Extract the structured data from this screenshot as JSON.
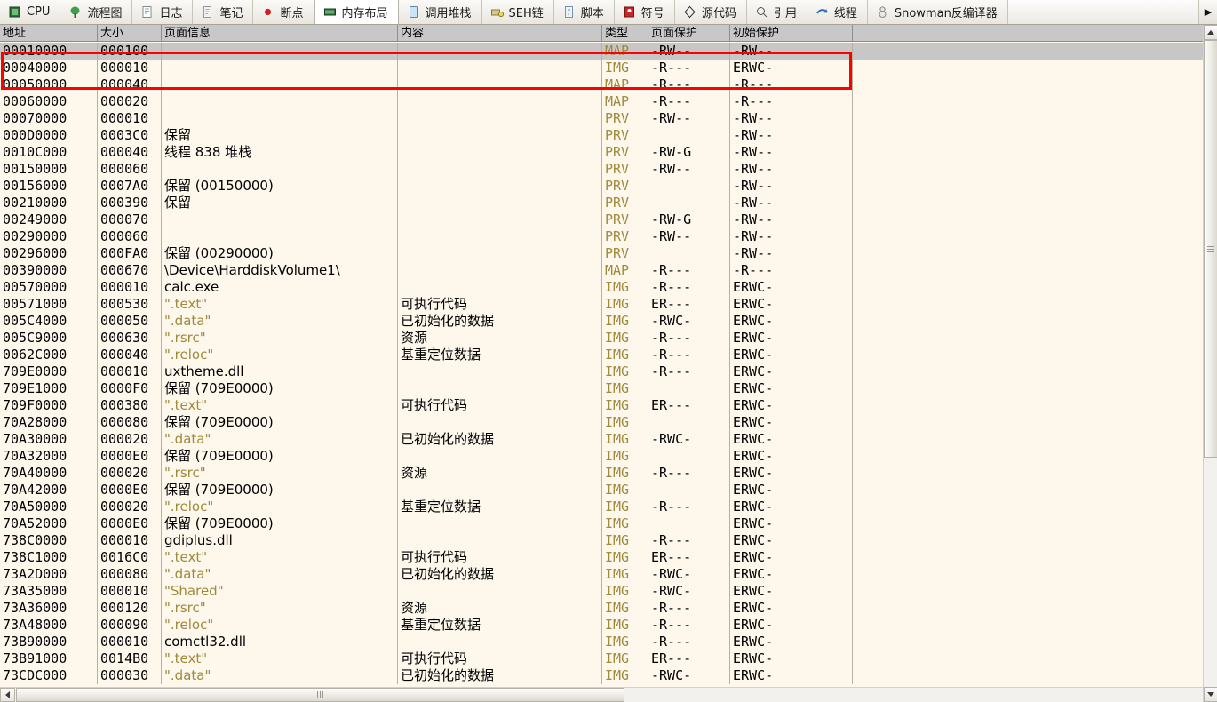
{
  "tabs": [
    {
      "label": "CPU",
      "icon": "cpu-icon",
      "active": false
    },
    {
      "label": "流程图",
      "icon": "graph-icon",
      "active": false
    },
    {
      "label": "日志",
      "icon": "log-icon",
      "active": false
    },
    {
      "label": "笔记",
      "icon": "notes-icon",
      "active": false
    },
    {
      "label": "断点",
      "icon": "breakpoint-icon",
      "active": false
    },
    {
      "label": "内存布局",
      "icon": "memory-icon",
      "active": true
    },
    {
      "label": "调用堆栈",
      "icon": "callstack-icon",
      "active": false
    },
    {
      "label": "SEH链",
      "icon": "seh-icon",
      "active": false
    },
    {
      "label": "脚本",
      "icon": "script-icon",
      "active": false
    },
    {
      "label": "符号",
      "icon": "symbols-icon",
      "active": false
    },
    {
      "label": "源代码",
      "icon": "source-icon",
      "active": false
    },
    {
      "label": "引用",
      "icon": "references-icon",
      "active": false
    },
    {
      "label": "线程",
      "icon": "threads-icon",
      "active": false
    },
    {
      "label": "Snowman反编译器",
      "icon": "snowman-icon",
      "active": false
    }
  ],
  "tab_scroll_right": "▶",
  "columns": [
    {
      "key": "address",
      "label": "地址"
    },
    {
      "key": "size",
      "label": "大小"
    },
    {
      "key": "page_info",
      "label": "页面信息"
    },
    {
      "key": "content",
      "label": "内容"
    },
    {
      "key": "type",
      "label": "类型"
    },
    {
      "key": "page_protect",
      "label": "页面保护"
    },
    {
      "key": "initial_protect",
      "label": "初始保护"
    }
  ],
  "selected_row_index": 0,
  "rows": [
    {
      "address": "00010000",
      "size": "000100",
      "page_info": "",
      "content": "",
      "type": "MAP",
      "page_protect": "-RW--",
      "initial_protect": "-RW--",
      "section": false
    },
    {
      "address": "00040000",
      "size": "000010",
      "page_info": "",
      "content": "",
      "type": "IMG",
      "page_protect": "-R---",
      "initial_protect": "ERWC-",
      "section": false
    },
    {
      "address": "00050000",
      "size": "000040",
      "page_info": "",
      "content": "",
      "type": "MAP",
      "page_protect": "-R---",
      "initial_protect": "-R---",
      "section": false
    },
    {
      "address": "00060000",
      "size": "000020",
      "page_info": "",
      "content": "",
      "type": "MAP",
      "page_protect": "-R---",
      "initial_protect": "-R---",
      "section": false
    },
    {
      "address": "00070000",
      "size": "000010",
      "page_info": "",
      "content": "",
      "type": "PRV",
      "page_protect": "-RW--",
      "initial_protect": "-RW--",
      "section": false
    },
    {
      "address": "000D0000",
      "size": "0003C0",
      "page_info": "保留",
      "content": "",
      "type": "PRV",
      "page_protect": "",
      "initial_protect": "-RW--",
      "section": false
    },
    {
      "address": "0010C000",
      "size": "000040",
      "page_info": "线程 838 堆栈",
      "content": "",
      "type": "PRV",
      "page_protect": "-RW-G",
      "initial_protect": "-RW--",
      "section": false
    },
    {
      "address": "00150000",
      "size": "000060",
      "page_info": "",
      "content": "",
      "type": "PRV",
      "page_protect": "-RW--",
      "initial_protect": "-RW--",
      "section": false
    },
    {
      "address": "00156000",
      "size": "0007A0",
      "page_info": "保留 (00150000)",
      "content": "",
      "type": "PRV",
      "page_protect": "",
      "initial_protect": "-RW--",
      "section": false
    },
    {
      "address": "00210000",
      "size": "000390",
      "page_info": "保留",
      "content": "",
      "type": "PRV",
      "page_protect": "",
      "initial_protect": "-RW--",
      "section": false
    },
    {
      "address": "00249000",
      "size": "000070",
      "page_info": "",
      "content": "",
      "type": "PRV",
      "page_protect": "-RW-G",
      "initial_protect": "-RW--",
      "section": false
    },
    {
      "address": "00290000",
      "size": "000060",
      "page_info": "",
      "content": "",
      "type": "PRV",
      "page_protect": "-RW--",
      "initial_protect": "-RW--",
      "section": false
    },
    {
      "address": "00296000",
      "size": "000FA0",
      "page_info": "保留 (00290000)",
      "content": "",
      "type": "PRV",
      "page_protect": "",
      "initial_protect": "-RW--",
      "section": false
    },
    {
      "address": "00390000",
      "size": "000670",
      "page_info": "\\Device\\HarddiskVolume1\\",
      "content": "",
      "type": "MAP",
      "page_protect": "-R---",
      "initial_protect": "-R---",
      "section": false
    },
    {
      "address": "00570000",
      "size": "000010",
      "page_info": "calc.exe",
      "content": "",
      "type": "IMG",
      "page_protect": "-R---",
      "initial_protect": "ERWC-",
      "section": false
    },
    {
      "address": "00571000",
      "size": "000530",
      "page_info": "\".text\"",
      "content": "可执行代码",
      "type": "IMG",
      "page_protect": "ER---",
      "initial_protect": "ERWC-",
      "section": true
    },
    {
      "address": "005C4000",
      "size": "000050",
      "page_info": "\".data\"",
      "content": "已初始化的数据",
      "type": "IMG",
      "page_protect": "-RWC-",
      "initial_protect": "ERWC-",
      "section": true
    },
    {
      "address": "005C9000",
      "size": "000630",
      "page_info": "\".rsrc\"",
      "content": "资源",
      "type": "IMG",
      "page_protect": "-R---",
      "initial_protect": "ERWC-",
      "section": true
    },
    {
      "address": "0062C000",
      "size": "000040",
      "page_info": "\".reloc\"",
      "content": "基重定位数据",
      "type": "IMG",
      "page_protect": "-R---",
      "initial_protect": "ERWC-",
      "section": true
    },
    {
      "address": "709E0000",
      "size": "000010",
      "page_info": "uxtheme.dll",
      "content": "",
      "type": "IMG",
      "page_protect": "-R---",
      "initial_protect": "ERWC-",
      "section": false
    },
    {
      "address": "709E1000",
      "size": "0000F0",
      "page_info": "保留 (709E0000)",
      "content": "",
      "type": "IMG",
      "page_protect": "",
      "initial_protect": "ERWC-",
      "section": false
    },
    {
      "address": "709F0000",
      "size": "000380",
      "page_info": "\".text\"",
      "content": "可执行代码",
      "type": "IMG",
      "page_protect": "ER---",
      "initial_protect": "ERWC-",
      "section": true
    },
    {
      "address": "70A28000",
      "size": "000080",
      "page_info": "保留 (709E0000)",
      "content": "",
      "type": "IMG",
      "page_protect": "",
      "initial_protect": "ERWC-",
      "section": false
    },
    {
      "address": "70A30000",
      "size": "000020",
      "page_info": "\".data\"",
      "content": "已初始化的数据",
      "type": "IMG",
      "page_protect": "-RWC-",
      "initial_protect": "ERWC-",
      "section": true
    },
    {
      "address": "70A32000",
      "size": "0000E0",
      "page_info": "保留 (709E0000)",
      "content": "",
      "type": "IMG",
      "page_protect": "",
      "initial_protect": "ERWC-",
      "section": false
    },
    {
      "address": "70A40000",
      "size": "000020",
      "page_info": "\".rsrc\"",
      "content": "资源",
      "type": "IMG",
      "page_protect": "-R---",
      "initial_protect": "ERWC-",
      "section": true
    },
    {
      "address": "70A42000",
      "size": "0000E0",
      "page_info": "保留 (709E0000)",
      "content": "",
      "type": "IMG",
      "page_protect": "",
      "initial_protect": "ERWC-",
      "section": false
    },
    {
      "address": "70A50000",
      "size": "000020",
      "page_info": "\".reloc\"",
      "content": "基重定位数据",
      "type": "IMG",
      "page_protect": "-R---",
      "initial_protect": "ERWC-",
      "section": true
    },
    {
      "address": "70A52000",
      "size": "0000E0",
      "page_info": "保留 (709E0000)",
      "content": "",
      "type": "IMG",
      "page_protect": "",
      "initial_protect": "ERWC-",
      "section": false
    },
    {
      "address": "738C0000",
      "size": "000010",
      "page_info": "gdiplus.dll",
      "content": "",
      "type": "IMG",
      "page_protect": "-R---",
      "initial_protect": "ERWC-",
      "section": false
    },
    {
      "address": "738C1000",
      "size": "0016C0",
      "page_info": "\".text\"",
      "content": "可执行代码",
      "type": "IMG",
      "page_protect": "ER---",
      "initial_protect": "ERWC-",
      "section": true
    },
    {
      "address": "73A2D000",
      "size": "000080",
      "page_info": "\".data\"",
      "content": "已初始化的数据",
      "type": "IMG",
      "page_protect": "-RWC-",
      "initial_protect": "ERWC-",
      "section": true
    },
    {
      "address": "73A35000",
      "size": "000010",
      "page_info": "\"Shared\"",
      "content": "",
      "type": "IMG",
      "page_protect": "-RWC-",
      "initial_protect": "ERWC-",
      "section": true
    },
    {
      "address": "73A36000",
      "size": "000120",
      "page_info": "\".rsrc\"",
      "content": "资源",
      "type": "IMG",
      "page_protect": "-R---",
      "initial_protect": "ERWC-",
      "section": true
    },
    {
      "address": "73A48000",
      "size": "000090",
      "page_info": "\".reloc\"",
      "content": "基重定位数据",
      "type": "IMG",
      "page_protect": "-R---",
      "initial_protect": "ERWC-",
      "section": true
    },
    {
      "address": "73B90000",
      "size": "000010",
      "page_info": "comctl32.dll",
      "content": "",
      "type": "IMG",
      "page_protect": "-R---",
      "initial_protect": "ERWC-",
      "section": false
    },
    {
      "address": "73B91000",
      "size": "0014B0",
      "page_info": "\".text\"",
      "content": "可执行代码",
      "type": "IMG",
      "page_protect": "ER---",
      "initial_protect": "ERWC-",
      "section": true
    },
    {
      "address": "73CDC000",
      "size": "000030",
      "page_info": "\".data\"",
      "content": "已初始化的数据",
      "type": "IMG",
      "page_protect": "-RWC-",
      "initial_protect": "ERWC-",
      "section": true
    }
  ],
  "scrollbars": {
    "v_up": "▲",
    "v_down": "▼",
    "h_left": "◀",
    "h_right": "▶"
  },
  "annotation": {
    "color": "#ff0000"
  }
}
